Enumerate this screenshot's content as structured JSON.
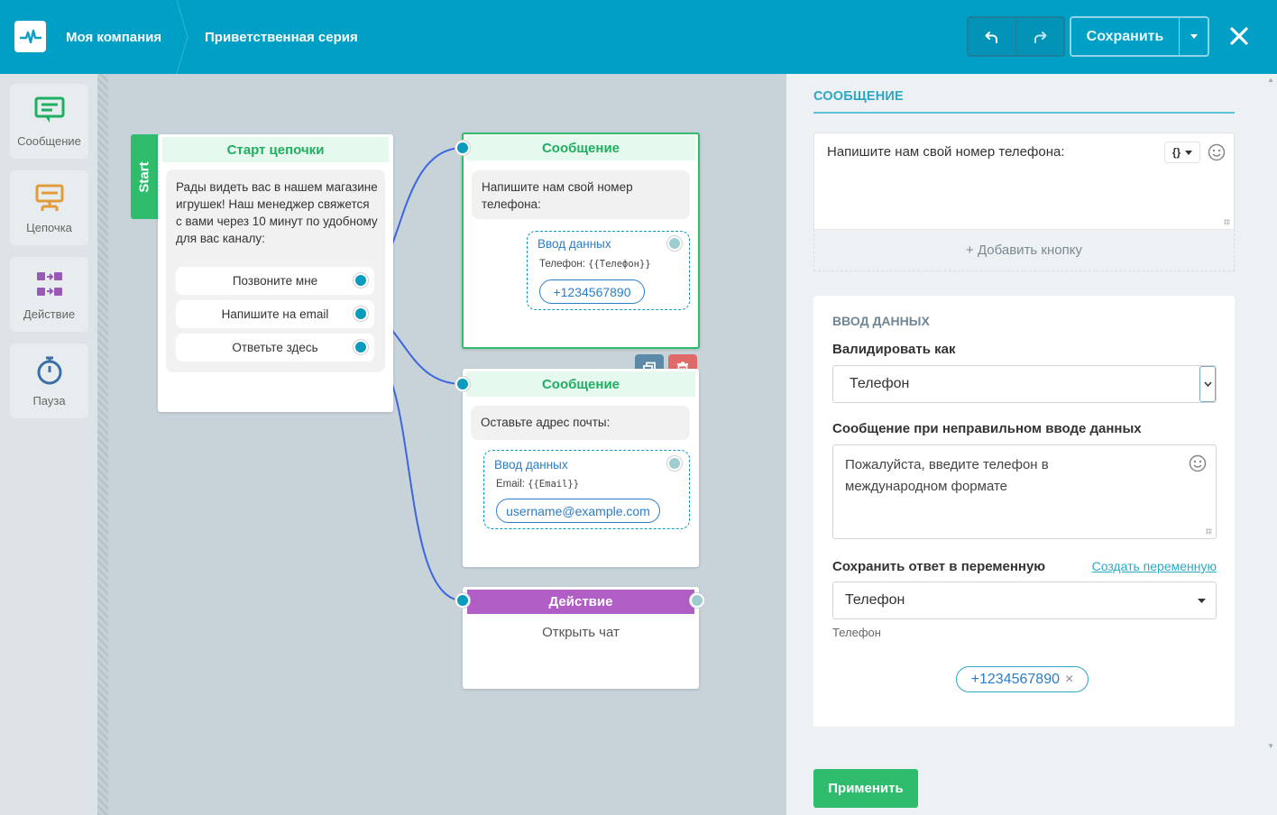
{
  "header": {
    "company": "Моя компания",
    "series": "Приветственная серия",
    "save_label": "Сохранить"
  },
  "toolbar": {
    "items": [
      {
        "label": "Сообщение",
        "icon": "message-icon"
      },
      {
        "label": "Цепочка",
        "icon": "chain-icon"
      },
      {
        "label": "Действие",
        "icon": "action-icon"
      },
      {
        "label": "Пауза",
        "icon": "timer-icon"
      }
    ]
  },
  "canvas": {
    "start": {
      "tab": "Start",
      "title": "Старт цепочки",
      "text": "Рады видеть вас в нашем магазине игрушек! Наш менеджер свяжется с вами через 10 минут по удобному для вас каналу:",
      "buttons": [
        "Позвоните мне",
        "Напишите на email",
        "Ответьте здесь"
      ]
    },
    "msg1": {
      "title": "Сообщение",
      "text": "Напишите нам свой номер телефона:",
      "input_title": "Ввод данных",
      "input_label": "Телефон:",
      "input_var": "{{Телефон}}",
      "input_value": "+1234567890"
    },
    "msg2": {
      "title": "Сообщение",
      "text": "Оставьте адрес почты:",
      "input_title": "Ввод данных",
      "input_label": "Email:",
      "input_var": "{{Email}}",
      "input_value": "username@example.com"
    },
    "action": {
      "title": "Действие",
      "text": "Открыть чат"
    }
  },
  "panel": {
    "heading": "СООБЩЕНИЕ",
    "message_text": "Напишите нам свой номер телефона:",
    "var_button": "{}",
    "add_button": "+ Добавить кнопку",
    "input_section": "ВВОД ДАННЫХ",
    "validate_label": "Валидировать как",
    "validate_value": "Телефон",
    "error_label": "Сообщение при неправильном вводе данных",
    "error_text": "Пожалуйста, введите  телефон в международном формате",
    "save_var_label": "Сохранить ответ в переменную",
    "create_var_link": "Создать переменную",
    "save_var_value": "Телефон",
    "save_var_hint": "Телефон",
    "chip_value": "+1234567890",
    "chip_remove": "×",
    "apply_label": "Применить"
  },
  "colors": {
    "header": "#00a0c6",
    "green": "#2fbc6c",
    "action": "#b05ec5",
    "port": "#0a9bbd",
    "wire": "#3a66e0"
  }
}
